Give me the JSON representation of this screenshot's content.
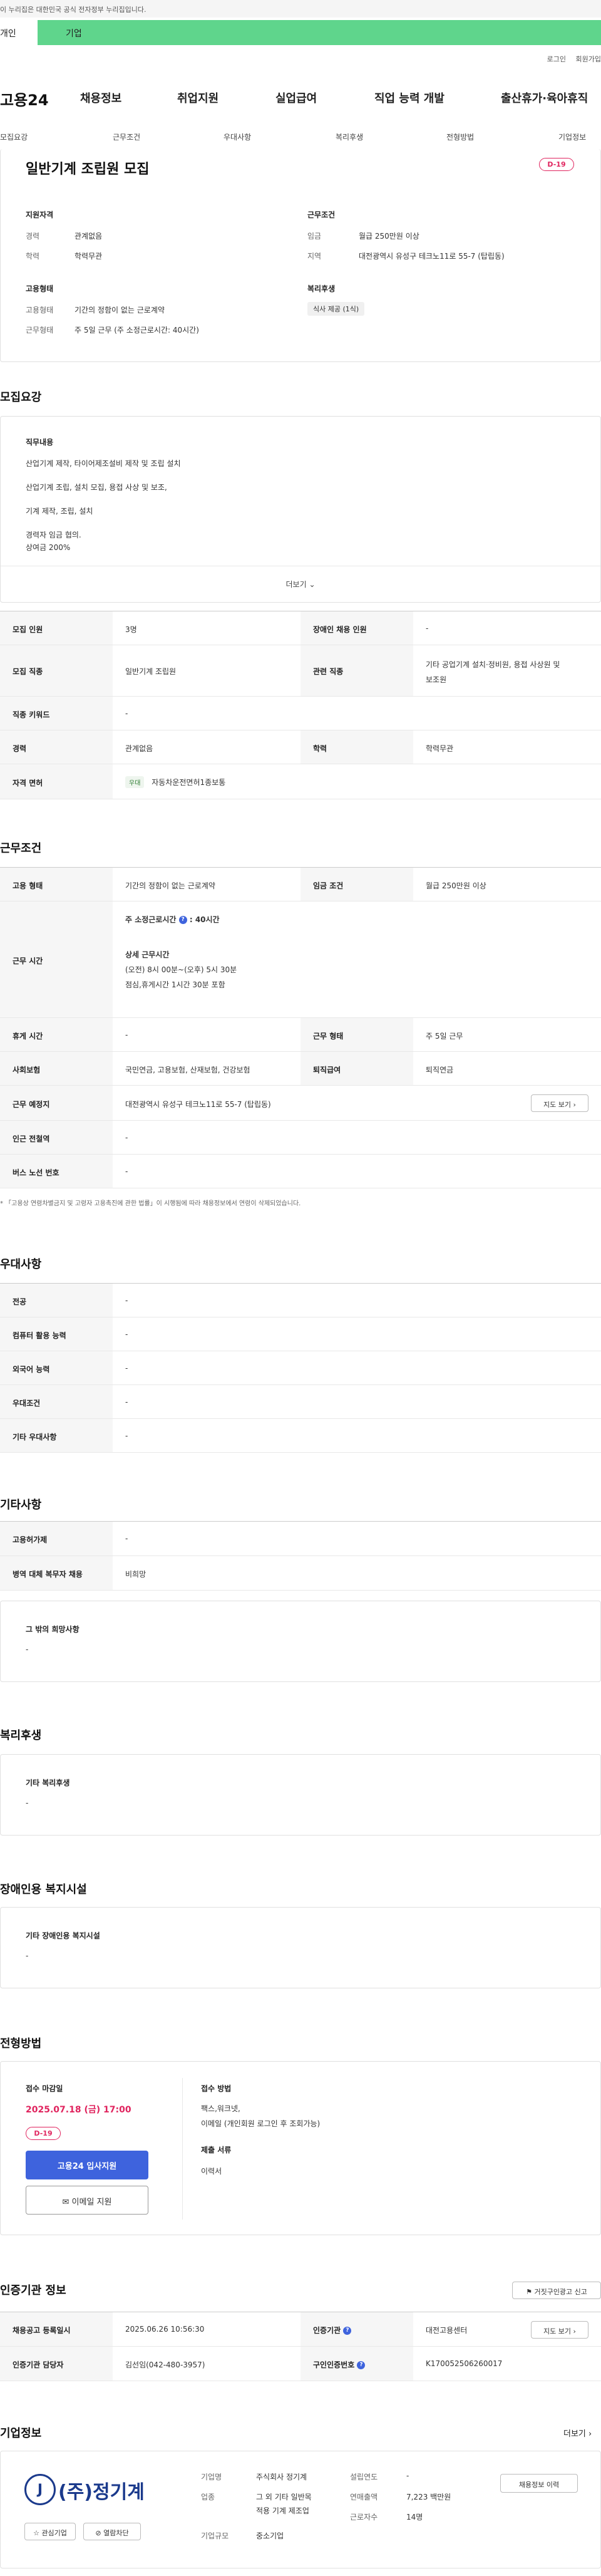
{
  "gov_banner": "이 누리집은 대한민국 공식 전자정부 누리집입니다.",
  "user_tabs": {
    "personal": "개인",
    "company": "기업"
  },
  "util_links": [
    "로그인",
    "회원가입"
  ],
  "logo": "고용24",
  "gnav": [
    "채용정보",
    "취업지원",
    "실업급여",
    "직업 능력 개발",
    "출산휴가·육아휴직"
  ],
  "subnav": [
    "모집요강",
    "근무조건",
    "우대사항",
    "복리후생",
    "전형방법",
    "기업정보"
  ],
  "summary": {
    "title": "일반기계 조립원 모집",
    "dday": "D-19",
    "qual_heading": "지원자격",
    "career_label": "경력",
    "career": "관계없음",
    "edu_label": "학력",
    "edu": "학력무관",
    "cond_heading": "근무조건",
    "wage_label": "임금",
    "wage": "월급 250만원 이상",
    "region_label": "지역",
    "region": "대전광역시 유성구 테크노11로 55-7 (탑립동)",
    "emp_heading": "고용형태",
    "emptype_label": "고용형태",
    "emptype": "기간의 정함이 없는 근로계약",
    "worktype_label": "근무형태",
    "worktype": "주 5일 근무 (주 소정근로시간: 40시간)",
    "welfare_heading": "복리후생",
    "welfare_chip": "식사 제공 (1식)"
  },
  "recruit": {
    "heading": "모집요강",
    "job_label": "직무내용",
    "job_lines": [
      "산업기계 제작, 타이어제조설비 제작 및 조립 설치",
      "산업기계 조립, 설치 모집, 용접 사상 및 보조,",
      "기계 제작, 조립, 설치",
      "경력자 임금 협의.",
      "상여금 200%"
    ],
    "more": "더보기",
    "count_label": "모집 인원",
    "count": "3명",
    "disabled_label": "장애인 채용 인원",
    "disabled": "-",
    "job_label2": "모집 직종",
    "job": "일반기계 조립원",
    "related_label": "관련 직종",
    "related": [
      "기타 공업기계 설치·정비원, 용접 사상원 및",
      "보조원"
    ],
    "keyword_label": "직종 키워드",
    "keyword": "-",
    "career_label": "경력",
    "career": "관계없음",
    "edu_label": "학력",
    "edu": "학력무관",
    "license_label": "자격 면허",
    "license_chip": "우대",
    "license": "자동차운전면허1종보통"
  },
  "conditions": {
    "heading": "근무조건",
    "emptype_label": "고용 형태",
    "emptype": "기간의 정함이 없는 근로계약",
    "wage_label": "임금 조건",
    "wage": "월급 250만원 이상",
    "hours_label": "근무 시간",
    "hours_week": "주 소정근로시간",
    "hours_week_value": ": 40시간",
    "detail_label": "상세 근무시간",
    "detail_lines": [
      "(오전) 8시 00분~(오후) 5시 30분",
      "점심,휴게시간 1시간 30분 포함"
    ],
    "rest_label": "휴게 시간",
    "rest": "-",
    "shape_label": "근무 형태",
    "shape": "주 5일 근무",
    "insurance_label": "사회보험",
    "insurance": "국민연금, 고용보험, 산재보험, 건강보험",
    "retire_label": "퇴직급여",
    "retire": "퇴직연금",
    "place_label": "근무 예정지",
    "place": "대전광역시 유성구 테크노11로 55-7 (탑립동)",
    "map_btn": "지도 보기",
    "station_label": "인근 전철역",
    "station": "-",
    "bus_label": "버스 노선 번호",
    "bus": "-",
    "note": "* 「고용상 연령차별금지 및 고령자 고용촉진에 관한 법률」이 시행됨에 따라 채용정보에서 연령이 삭제되었습니다."
  },
  "preference": {
    "heading": "우대사항",
    "rows": [
      {
        "label": "전공",
        "value": "-"
      },
      {
        "label": "컴퓨터 활용 능력",
        "value": "-"
      },
      {
        "label": "외국어 능력",
        "value": "-"
      },
      {
        "label": "우대조건",
        "value": "-"
      },
      {
        "label": "기타 우대사항",
        "value": "-"
      }
    ]
  },
  "etc": {
    "heading": "기타사항",
    "rows": [
      {
        "label": "고용허가제",
        "value": "-"
      },
      {
        "label": "병역 대체 복무자 채용",
        "value": "비희망"
      }
    ],
    "box_label": "그 밖의 희망사항",
    "box_value": "-"
  },
  "welfare": {
    "heading": "복리후생",
    "box_label": "기타 복리후생",
    "box_value": "-"
  },
  "disability": {
    "heading": "장애인용 복지시설",
    "box_label": "기타 장애인용 복지시설",
    "box_value": "-"
  },
  "selection": {
    "heading": "전형방법",
    "deadline_label": "접수 마감일",
    "deadline": "2025.07.18 (금) 17:00",
    "dday": "D-19",
    "apply_btn": "고용24 입사지원",
    "email_btn": "이메일 지원",
    "method_label": "접수 방법",
    "method_lines": [
      "팩스,워크넷,",
      "이메일 (개인회원 로그인 후 조회가능)"
    ],
    "docs_label": "제출 서류",
    "docs": "이력서"
  },
  "agency": {
    "heading": "인증기관 정보",
    "report_btn": "거짓구인광고 신고",
    "reg_label": "채용공고 등록일시",
    "reg": "2025.06.26 10:56:30",
    "agency_label": "인증기관",
    "agency": "대전고용센터",
    "map_btn": "지도 보기",
    "manager_label": "인증기관 담당자",
    "manager": "김선임(042-480-3957)",
    "id_label": "구인인증번호",
    "id": "K170052506260017"
  },
  "company": {
    "heading": "기업정보",
    "more": "더보기",
    "logo_text": "(주)정기계",
    "fav_btn": "관심기업",
    "block_btn": "열람차단",
    "name_label": "기업명",
    "name": "주식회사 정기계",
    "industry_label": "업종",
    "industry_lines": [
      "그 외 기타 일반목",
      "적용 기계 제조업"
    ],
    "size_label": "기업규모",
    "size": "중소기업",
    "founded_label": "설립연도",
    "founded": "-",
    "sales_label": "연매출액",
    "sales": "7,223 백만원",
    "emp_label": "근로자수",
    "emp": "14명",
    "history_btn": "채용정보 이력"
  },
  "colors": {
    "accent_green": "#5fd58c",
    "dday_pink": "#e0245e",
    "primary_blue": "#3e63dd"
  }
}
